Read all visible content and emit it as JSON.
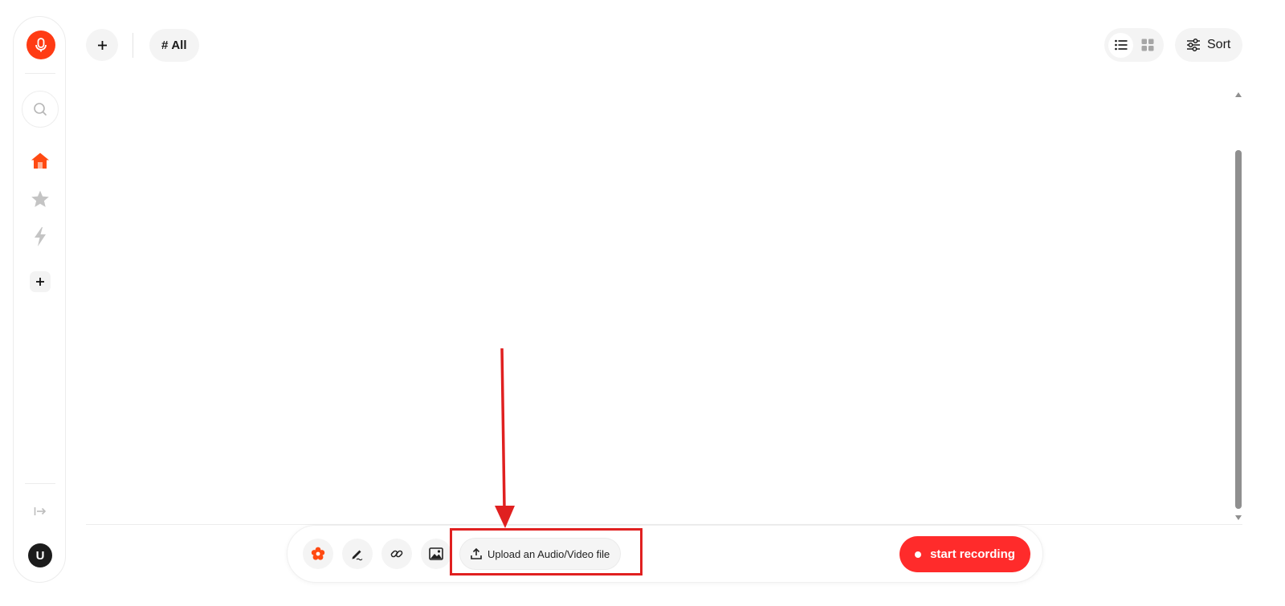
{
  "sidebar": {
    "logo_icon": "microphone-icon",
    "items": [
      {
        "name": "search",
        "icon": "search-icon",
        "active": false
      },
      {
        "name": "home",
        "icon": "home-icon",
        "active": true
      },
      {
        "name": "favorites",
        "icon": "star-icon",
        "active": false
      },
      {
        "name": "automations",
        "icon": "lightning-icon",
        "active": false
      }
    ],
    "add_icon": "plus-icon",
    "collapse_icon": "collapse-sidebar-icon",
    "avatar_initial": "U"
  },
  "header": {
    "add_icon": "plus-icon",
    "tag_filter": {
      "symbol": "#",
      "label": "All"
    },
    "view_modes": [
      {
        "name": "list",
        "icon": "list-icon",
        "active": true
      },
      {
        "name": "grid",
        "icon": "grid-icon",
        "active": false
      }
    ],
    "sort_label": "Sort",
    "sort_icon": "sliders-icon"
  },
  "bottom_bar": {
    "tools": [
      {
        "name": "ai-flower",
        "icon": "flower-icon"
      },
      {
        "name": "write",
        "icon": "pen-icon"
      },
      {
        "name": "link",
        "icon": "link-icon"
      },
      {
        "name": "image",
        "icon": "image-icon"
      }
    ],
    "upload_label": "Upload an Audio/Video file",
    "upload_icon": "upload-icon",
    "record_label": "start recording"
  },
  "colors": {
    "brand": "#ff3b14",
    "record": "#ff2b2b",
    "annotation": "#e02020",
    "surface": "#f4f4f4"
  }
}
